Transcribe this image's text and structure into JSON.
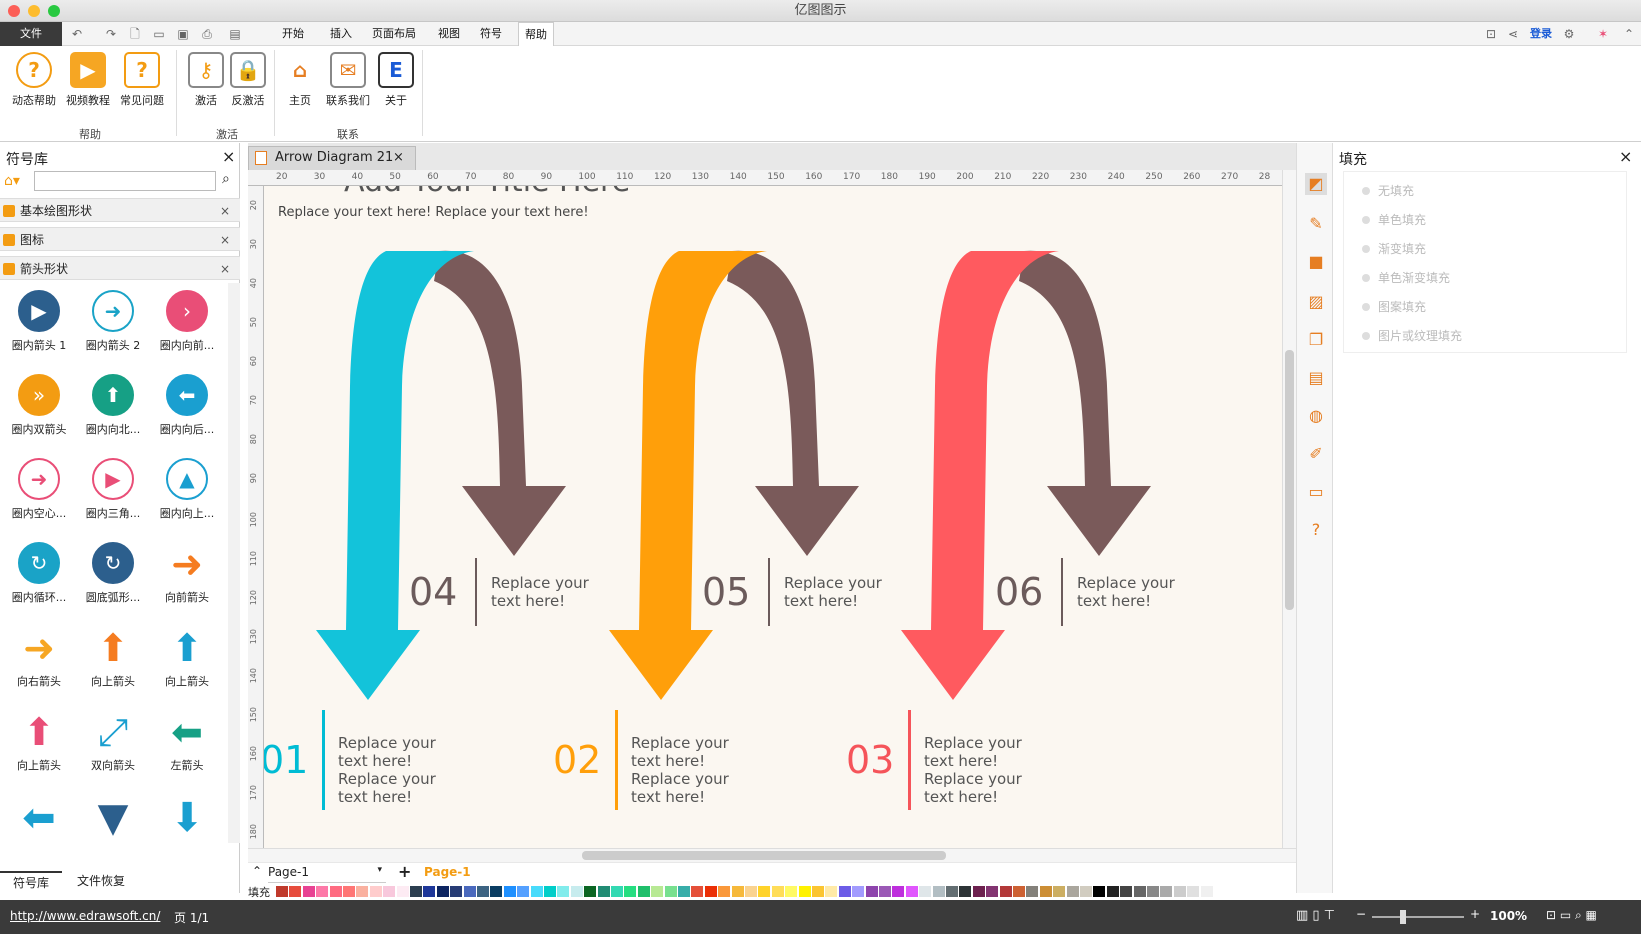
{
  "app_title": "亿图图示",
  "menu": {
    "file": "文件",
    "tabs": [
      "开始",
      "插入",
      "页面布局",
      "视图",
      "符号",
      "帮助"
    ],
    "active_tab": "帮助",
    "login": "登录"
  },
  "ribbon": {
    "groups": [
      {
        "label": "帮助",
        "buttons": [
          "动态帮助",
          "视频教程",
          "常见问题"
        ]
      },
      {
        "label": "激活",
        "buttons": [
          "激活",
          "反激活"
        ]
      },
      {
        "label": "联系",
        "buttons": [
          "主页",
          "联系我们",
          "关于"
        ]
      }
    ]
  },
  "left_panel": {
    "title": "符号库",
    "search_placeholder": "",
    "libraries": [
      "基本绘图形状",
      "图标",
      "箭头形状"
    ],
    "shapes": [
      "圈内箭头 1",
      "圈内箭头 2",
      "圈内向前...",
      "圈内双箭头",
      "圈内向北...",
      "圈内向后...",
      "圈内空心...",
      "圈内三角...",
      "圈内向上...",
      "圈内循环...",
      "圆底弧形...",
      "向前箭头",
      "向右箭头",
      "向上箭头",
      "向上箭头",
      "向上箭头",
      "双向箭头",
      "左箭头"
    ],
    "bottom_tabs": [
      "符号库",
      "文件恢复"
    ]
  },
  "document": {
    "tab_title": "Arrow Diagram 21",
    "ruler_ticks": [
      "20",
      "30",
      "40",
      "50",
      "60",
      "70",
      "80",
      "90",
      "100",
      "110",
      "120",
      "130",
      "140",
      "150",
      "160",
      "170",
      "180",
      "190",
      "200",
      "210",
      "220",
      "230",
      "240",
      "250",
      "260",
      "270",
      "28"
    ],
    "vruler_ticks": [
      "20",
      "30",
      "40",
      "50",
      "60",
      "70",
      "80",
      "90",
      "100",
      "110",
      "120",
      "130",
      "140",
      "150",
      "160",
      "170",
      "180"
    ],
    "diagram": {
      "title": "Add Your Title Here",
      "subtitle": "Replace your text here!  Replace your text here!",
      "top_items": [
        {
          "num": "04",
          "text": "Replace your text here!"
        },
        {
          "num": "05",
          "text": "Replace your text here!"
        },
        {
          "num": "06",
          "text": "Replace your text here!"
        }
      ],
      "bottom_items": [
        {
          "num": "01",
          "text": "Replace your text here!  Replace your text here!",
          "color": "#00BCD4"
        },
        {
          "num": "02",
          "text": "Replace your text here!  Replace your text here!",
          "color": "#FF9F0A"
        },
        {
          "num": "03",
          "text": "Replace your text here!  Replace your text here!",
          "color": "#F5545A"
        }
      ],
      "arrow_colors": [
        "#13C3DA",
        "#FF9F0A",
        "#FF5A5F"
      ],
      "back_arrow_color": "#7A5A5A"
    }
  },
  "fill_panel": {
    "title": "填充",
    "options": [
      "无填充",
      "单色填充",
      "渐变填充",
      "单色渐变填充",
      "图案填充",
      "图片或纹理填充"
    ]
  },
  "page_bar": {
    "page_select": "Page-1",
    "active_page": "Page-1",
    "fill_label": "填充"
  },
  "status": {
    "url": "http://www.edrawsoft.cn/",
    "page_info": "页 1/1",
    "zoom": "100%"
  }
}
